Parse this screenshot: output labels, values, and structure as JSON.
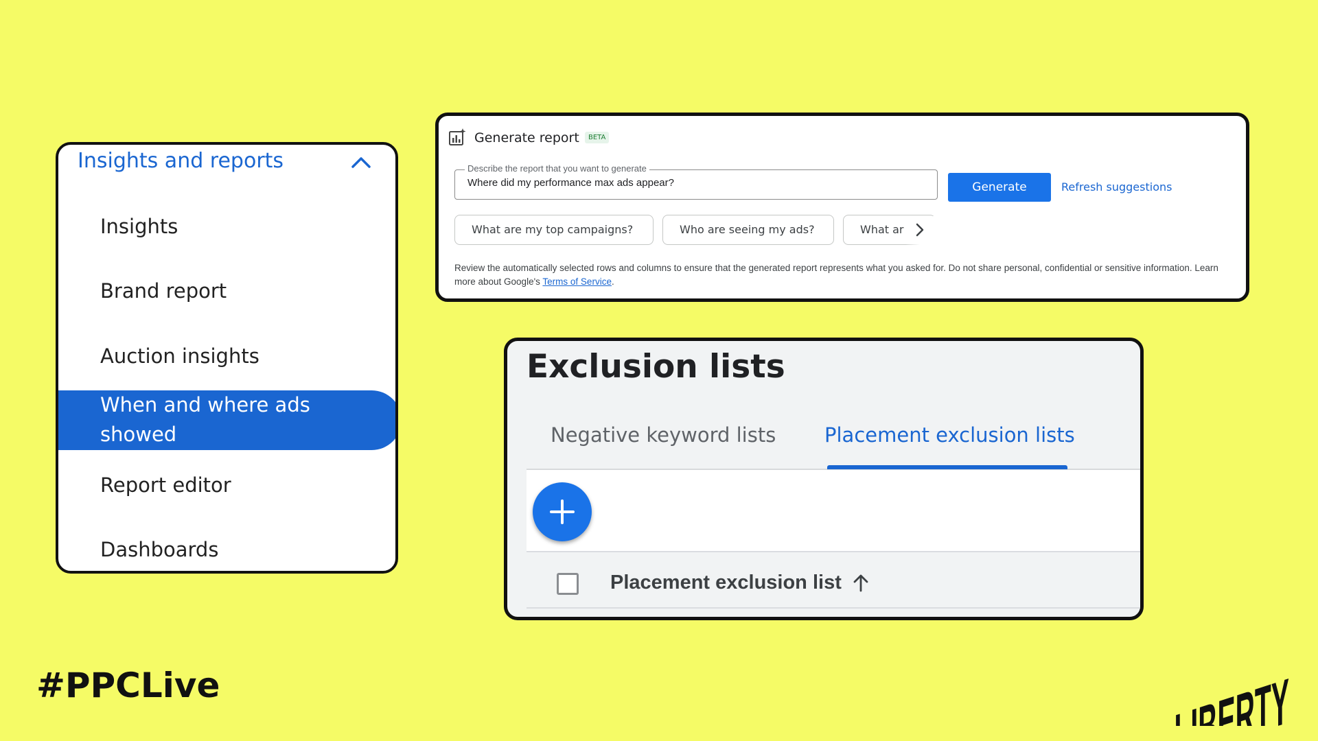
{
  "nav": {
    "title": "Insights and reports",
    "items": [
      {
        "label": "Insights",
        "active": false
      },
      {
        "label": "Brand report",
        "active": false
      },
      {
        "label": "Auction insights",
        "active": false
      },
      {
        "label": "When and where ads showed",
        "active": true
      },
      {
        "label": "Report editor",
        "active": false
      },
      {
        "label": "Dashboards",
        "active": false
      }
    ],
    "icons": {
      "collapse": "chevron-up-icon"
    }
  },
  "generate_report": {
    "title": "Generate report",
    "badge": "BETA",
    "input_label": "Describe the report that you want to generate",
    "input_value": "Where did my performance max ads appear?",
    "generate_label": "Generate",
    "refresh_label": "Refresh suggestions",
    "suggestions": [
      "What are my top campaigns?",
      "Who are seeing my ads?",
      "What ar"
    ],
    "disclaimer_text": "Review the automatically selected rows and columns to ensure that the generated report represents what you asked for. Do not share personal, confidential or sensitive information. Learn more about Google's ",
    "tos_label": "Terms of Service",
    "disclaimer_end": ".",
    "icons": {
      "header": "analytics-sparkle-icon",
      "scroll": "chevron-right-icon"
    }
  },
  "exclusion_lists": {
    "title": "Exclusion lists",
    "tabs": [
      {
        "label": "Negative keyword lists",
        "active": false
      },
      {
        "label": "Placement exclusion lists",
        "active": true
      }
    ],
    "column_header": "Placement exclusion list",
    "icons": {
      "add": "plus-icon",
      "sort": "arrow-up-icon"
    }
  },
  "footer": {
    "hashtag": "#PPCLive",
    "logo_text": "LIBERTY"
  },
  "colors": {
    "background": "#f5fb66",
    "accent": "#1a66d1",
    "button": "#1a73e8"
  }
}
